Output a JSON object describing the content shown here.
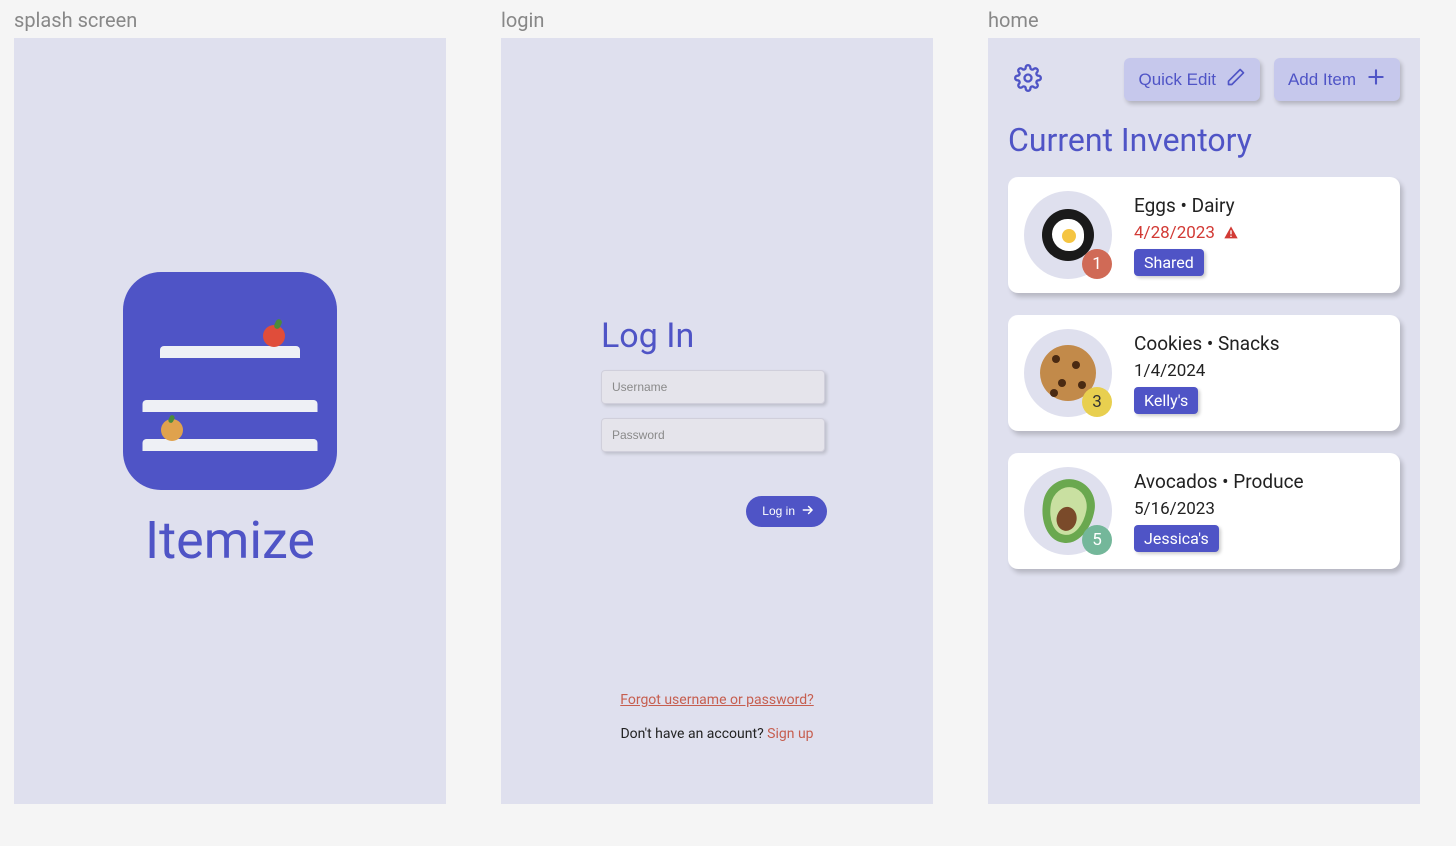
{
  "labels": {
    "splash": "splash screen",
    "login": "login",
    "home": "home"
  },
  "splash": {
    "app_name": "Itemize"
  },
  "login": {
    "title": "Log In",
    "username_placeholder": "Username",
    "password_placeholder": "Password",
    "login_button": "Log in",
    "forgot_link": "Forgot username or password?",
    "no_account_text": "Don't have an account? ",
    "signup_link": "Sign up"
  },
  "home": {
    "quick_edit": "Quick Edit",
    "add_item": "Add Item",
    "title": "Current Inventory",
    "items": [
      {
        "name": "Eggs",
        "category": "Dairy",
        "date": "4/28/2023",
        "expired": true,
        "count": "1",
        "badge_color": "#d06a56",
        "tag": "Shared",
        "icon": "egg"
      },
      {
        "name": "Cookies",
        "category": "Snacks",
        "date": "1/4/2024",
        "expired": false,
        "count": "3",
        "badge_color": "#e8cf4f",
        "tag": "Kelly's",
        "icon": "cookie"
      },
      {
        "name": "Avocados",
        "category": "Produce",
        "date": "5/16/2023",
        "expired": false,
        "count": "5",
        "badge_color": "#74b79a",
        "tag": "Jessica's",
        "icon": "avocado"
      }
    ]
  }
}
